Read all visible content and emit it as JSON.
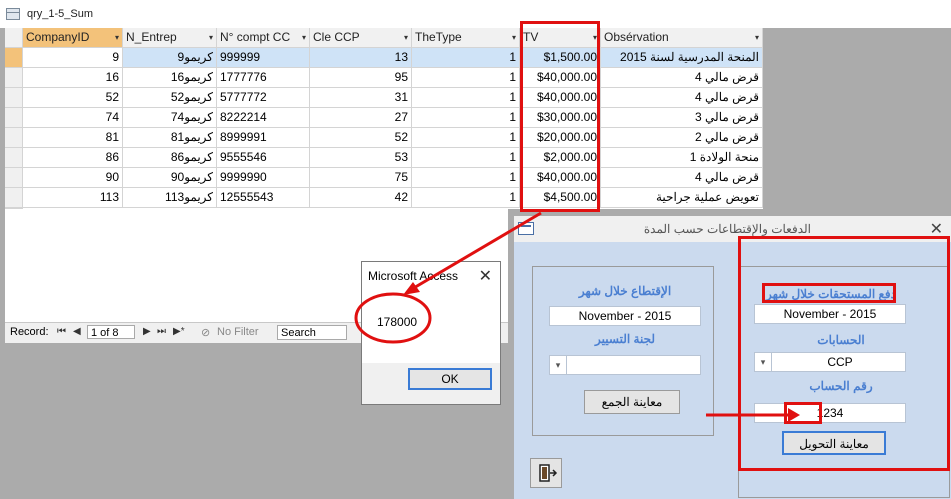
{
  "query": {
    "title": "qry_1-5_Sum",
    "columns": [
      "CompanyID",
      "N_Entrep",
      "N° compt CC",
      "Cle CCP",
      "TheType",
      "TV",
      "Obsérvation"
    ],
    "rows": [
      [
        "9",
        "كريمو9",
        "999999",
        "13",
        "1",
        "$1,500.00",
        "المنحة المدرسية لسنة 2015"
      ],
      [
        "16",
        "كريمو16",
        "1777776",
        "95",
        "1",
        "$40,000.00",
        "قرض مالي 4"
      ],
      [
        "52",
        "كريمو52",
        "5777772",
        "31",
        "1",
        "$40,000.00",
        "قرض مالي 4"
      ],
      [
        "74",
        "كريمو74",
        "8222214",
        "27",
        "1",
        "$30,000.00",
        "قرض مالي 3"
      ],
      [
        "81",
        "كريمو81",
        "8999991",
        "52",
        "1",
        "$20,000.00",
        "قرض مالي 2"
      ],
      [
        "86",
        "كريمو86",
        "9555546",
        "53",
        "1",
        "$2,000.00",
        "منحة الولادة 1"
      ],
      [
        "90",
        "كريمو90",
        "9999990",
        "75",
        "1",
        "$40,000.00",
        "قرض مالي 4"
      ],
      [
        "113",
        "كريمو113",
        "12555543",
        "42",
        "1",
        "$4,500.00",
        "تعويض عملية جراحية"
      ]
    ]
  },
  "navigation": {
    "record_label": "Record:",
    "record_position": "1 of 8",
    "no_filter": "No Filter",
    "search": "Search"
  },
  "msgbox": {
    "title": "Microsoft Access",
    "value": "178000",
    "ok": "OK"
  },
  "form": {
    "title": "الدفعات والإقتطاعات حسب المدة",
    "left": {
      "label1": "الإقتطاع خلال شهر",
      "month": "November - 2015",
      "label2": "لجنة التسيير",
      "combo_value": "",
      "button": "معاينة الجمع"
    },
    "right": {
      "label1": "دفع المستحقات خلال شهر:",
      "month": "November - 2015",
      "label2": "الحسابات",
      "account_type": "CCP",
      "label3": "رقم الحساب",
      "account_number": "1234",
      "button": "معاينة التحويل"
    }
  },
  "colors": {
    "annotation": "#e01010",
    "form_label": "#4a7fd1",
    "selected_header": "#f3c27a"
  }
}
